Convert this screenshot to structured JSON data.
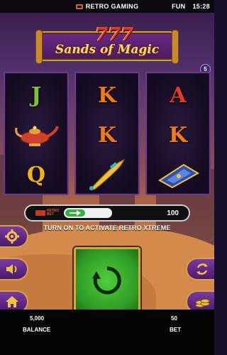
{
  "topbar": {
    "brand": "RETRO GAMING",
    "mode": "FUN",
    "time": "15:28"
  },
  "game": {
    "title_number": "777",
    "title": "Sands of Magic",
    "level": "5"
  },
  "reels": [
    [
      {
        "kind": "letter",
        "text": "J",
        "color": "#7ac23a"
      },
      {
        "kind": "icon",
        "icon": "magic-lamp-icon"
      },
      {
        "kind": "letter",
        "text": "Q",
        "color": "#f0b21a"
      }
    ],
    [
      {
        "kind": "letter",
        "text": "K",
        "color": "#f07a1a"
      },
      {
        "kind": "letter",
        "text": "K",
        "color": "#f07a1a"
      },
      {
        "kind": "icon",
        "icon": "dagger-icon"
      }
    ],
    [
      {
        "kind": "letter",
        "text": "A",
        "color": "#e03a2a"
      },
      {
        "kind": "letter",
        "text": "K",
        "color": "#f07a1a"
      },
      {
        "kind": "icon",
        "icon": "flying-carpet-icon"
      }
    ]
  ],
  "retro_bet": {
    "logo_line1": "RETRO",
    "logo_line2": "BET",
    "value": "100",
    "caption": "TURN ON TO ACTIVATE RETRO XTREME"
  },
  "bottom": {
    "balance_value": "5,000",
    "balance_label": "BALANCE",
    "bet_value": "50",
    "bet_label": "BET"
  },
  "colors": {
    "gold_border": "#d9a13a",
    "button_purple": "#5a2a82",
    "spin_green": "#3fbf2f"
  }
}
